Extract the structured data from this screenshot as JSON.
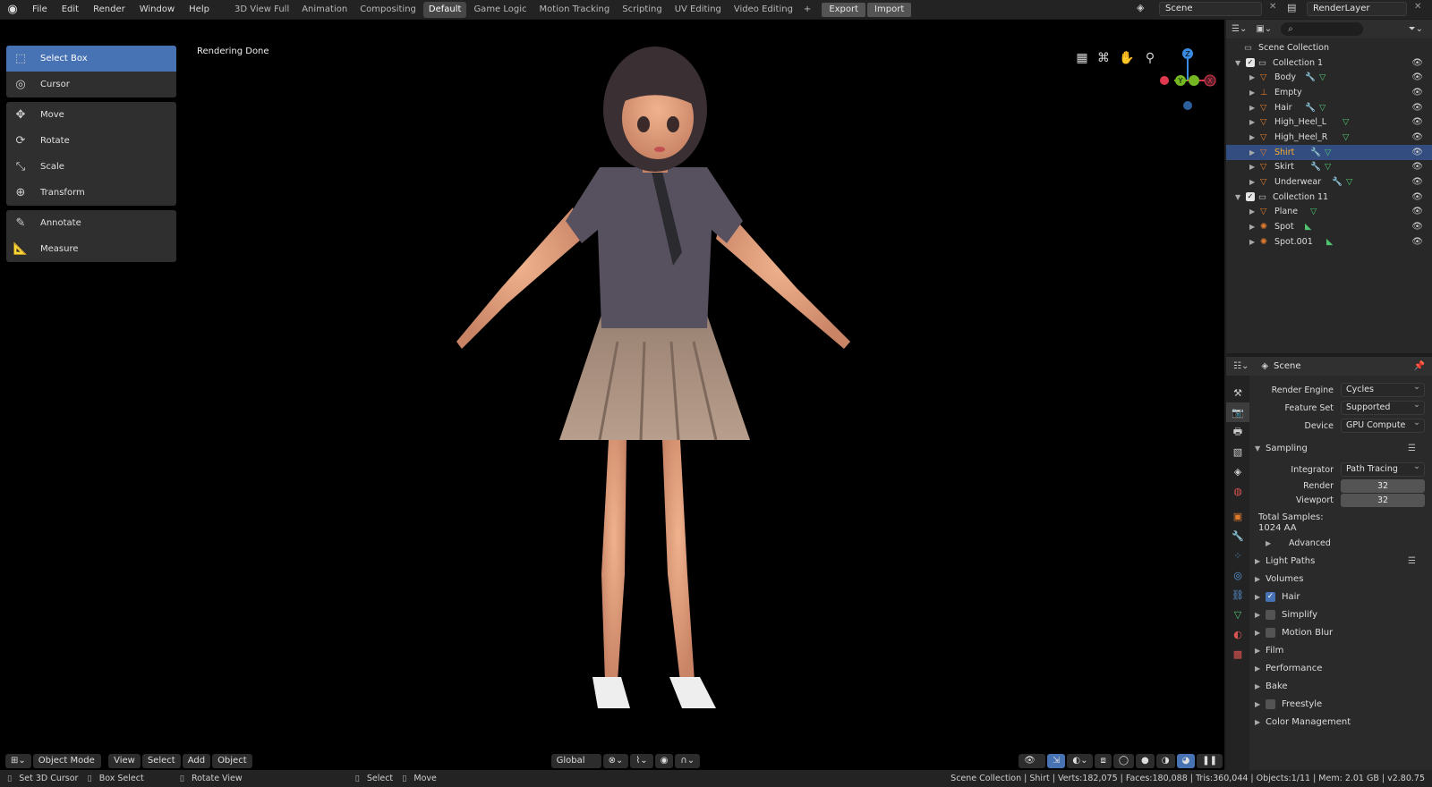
{
  "top_menu": [
    "File",
    "Edit",
    "Render",
    "Window",
    "Help"
  ],
  "workspaces": [
    "3D View Full",
    "Animation",
    "Compositing",
    "Default",
    "Game Logic",
    "Motion Tracking",
    "Scripting",
    "UV Editing",
    "Video Editing"
  ],
  "active_workspace": "Default",
  "export_label": "Export",
  "import_label": "Import",
  "scene_name": "Scene",
  "view_layer": "RenderLayer",
  "tools": {
    "select_box": "Select Box",
    "cursor": "Cursor",
    "move": "Move",
    "rotate": "Rotate",
    "scale": "Scale",
    "transform": "Transform",
    "annotate": "Annotate",
    "measure": "Measure"
  },
  "viewport_status": "Rendering Done",
  "gizmo": {
    "z": "Z",
    "y": "Y",
    "x": "X"
  },
  "viewport_header": {
    "mode": "Object Mode",
    "view": "View",
    "select": "Select",
    "add": "Add",
    "object": "Object",
    "orientation": "Global"
  },
  "statusbar": {
    "set_cursor": "Set 3D Cursor",
    "box_select": "Box Select",
    "rotate_view": "Rotate View",
    "select": "Select",
    "move": "Move",
    "stats": "Scene Collection | Shirt | Verts:182,075 | Faces:180,088 | Tris:360,044 | Objects:1/11 | Mem: 2.01 GB | v2.80.75"
  },
  "outliner": {
    "root": "Scene Collection",
    "rows": [
      {
        "name": "Collection 1",
        "type": "collection"
      },
      {
        "name": "Body",
        "type": "mesh"
      },
      {
        "name": "Empty",
        "type": "empty"
      },
      {
        "name": "Hair",
        "type": "mesh"
      },
      {
        "name": "High_Heel_L",
        "type": "mesh"
      },
      {
        "name": "High_Heel_R",
        "type": "mesh"
      },
      {
        "name": "Shirt",
        "type": "mesh"
      },
      {
        "name": "Skirt",
        "type": "mesh"
      },
      {
        "name": "Underwear",
        "type": "mesh"
      },
      {
        "name": "Collection 11",
        "type": "collection"
      },
      {
        "name": "Plane",
        "type": "mesh"
      },
      {
        "name": "Spot",
        "type": "light"
      },
      {
        "name": "Spot.001",
        "type": "light"
      }
    ]
  },
  "properties": {
    "header": "Scene",
    "render_engine_label": "Render Engine",
    "render_engine": "Cycles",
    "feature_set_label": "Feature Set",
    "feature_set": "Supported",
    "device_label": "Device",
    "device": "GPU Compute",
    "sampling": "Sampling",
    "integrator_label": "Integrator",
    "integrator": "Path Tracing",
    "render_label": "Render",
    "render_samples": "32",
    "viewport_label": "Viewport",
    "viewport_samples": "32",
    "total_samples_label": "Total Samples:",
    "total_samples": "1024 AA",
    "advanced": "Advanced",
    "light_paths": "Light Paths",
    "volumes": "Volumes",
    "hair": "Hair",
    "simplify": "Simplify",
    "motion_blur": "Motion Blur",
    "film": "Film",
    "performance": "Performance",
    "bake": "Bake",
    "freestyle": "Freestyle",
    "color_management": "Color Management"
  },
  "colors": {
    "accent": "#4772b3",
    "selected_text": "#ffaf29",
    "mesh_icon": "#e07b2d",
    "x_axis": "#e0394f",
    "y_axis": "#75b722",
    "z_axis": "#3a8ae0"
  }
}
